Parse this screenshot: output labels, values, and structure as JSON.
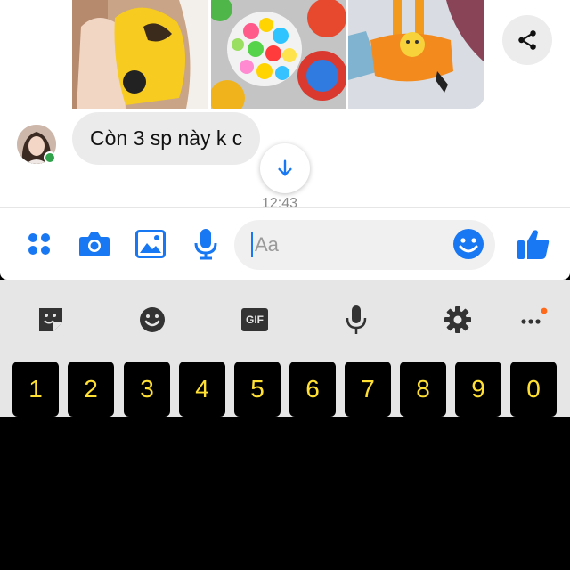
{
  "messages": {
    "bubble_text": "Còn 3 sp này k c",
    "timestamp": "12:43"
  },
  "composer": {
    "placeholder": "Aa"
  },
  "keyboard": {
    "gif_label": "GIF",
    "number_keys": [
      "1",
      "2",
      "3",
      "4",
      "5",
      "6",
      "7",
      "8",
      "9",
      "0"
    ]
  },
  "colors": {
    "messenger_blue": "#1877f2",
    "bubble_gray": "#ebebeb",
    "key_text": "#ffe033",
    "online_green": "#31a24c"
  },
  "icons": [
    "share-icon",
    "arrow-down-icon",
    "apps-icon",
    "camera-icon",
    "image-icon",
    "microphone-icon",
    "emoji-icon",
    "thumbs-up-icon",
    "sticker-icon",
    "gif-icon",
    "settings-icon",
    "more-icon"
  ]
}
